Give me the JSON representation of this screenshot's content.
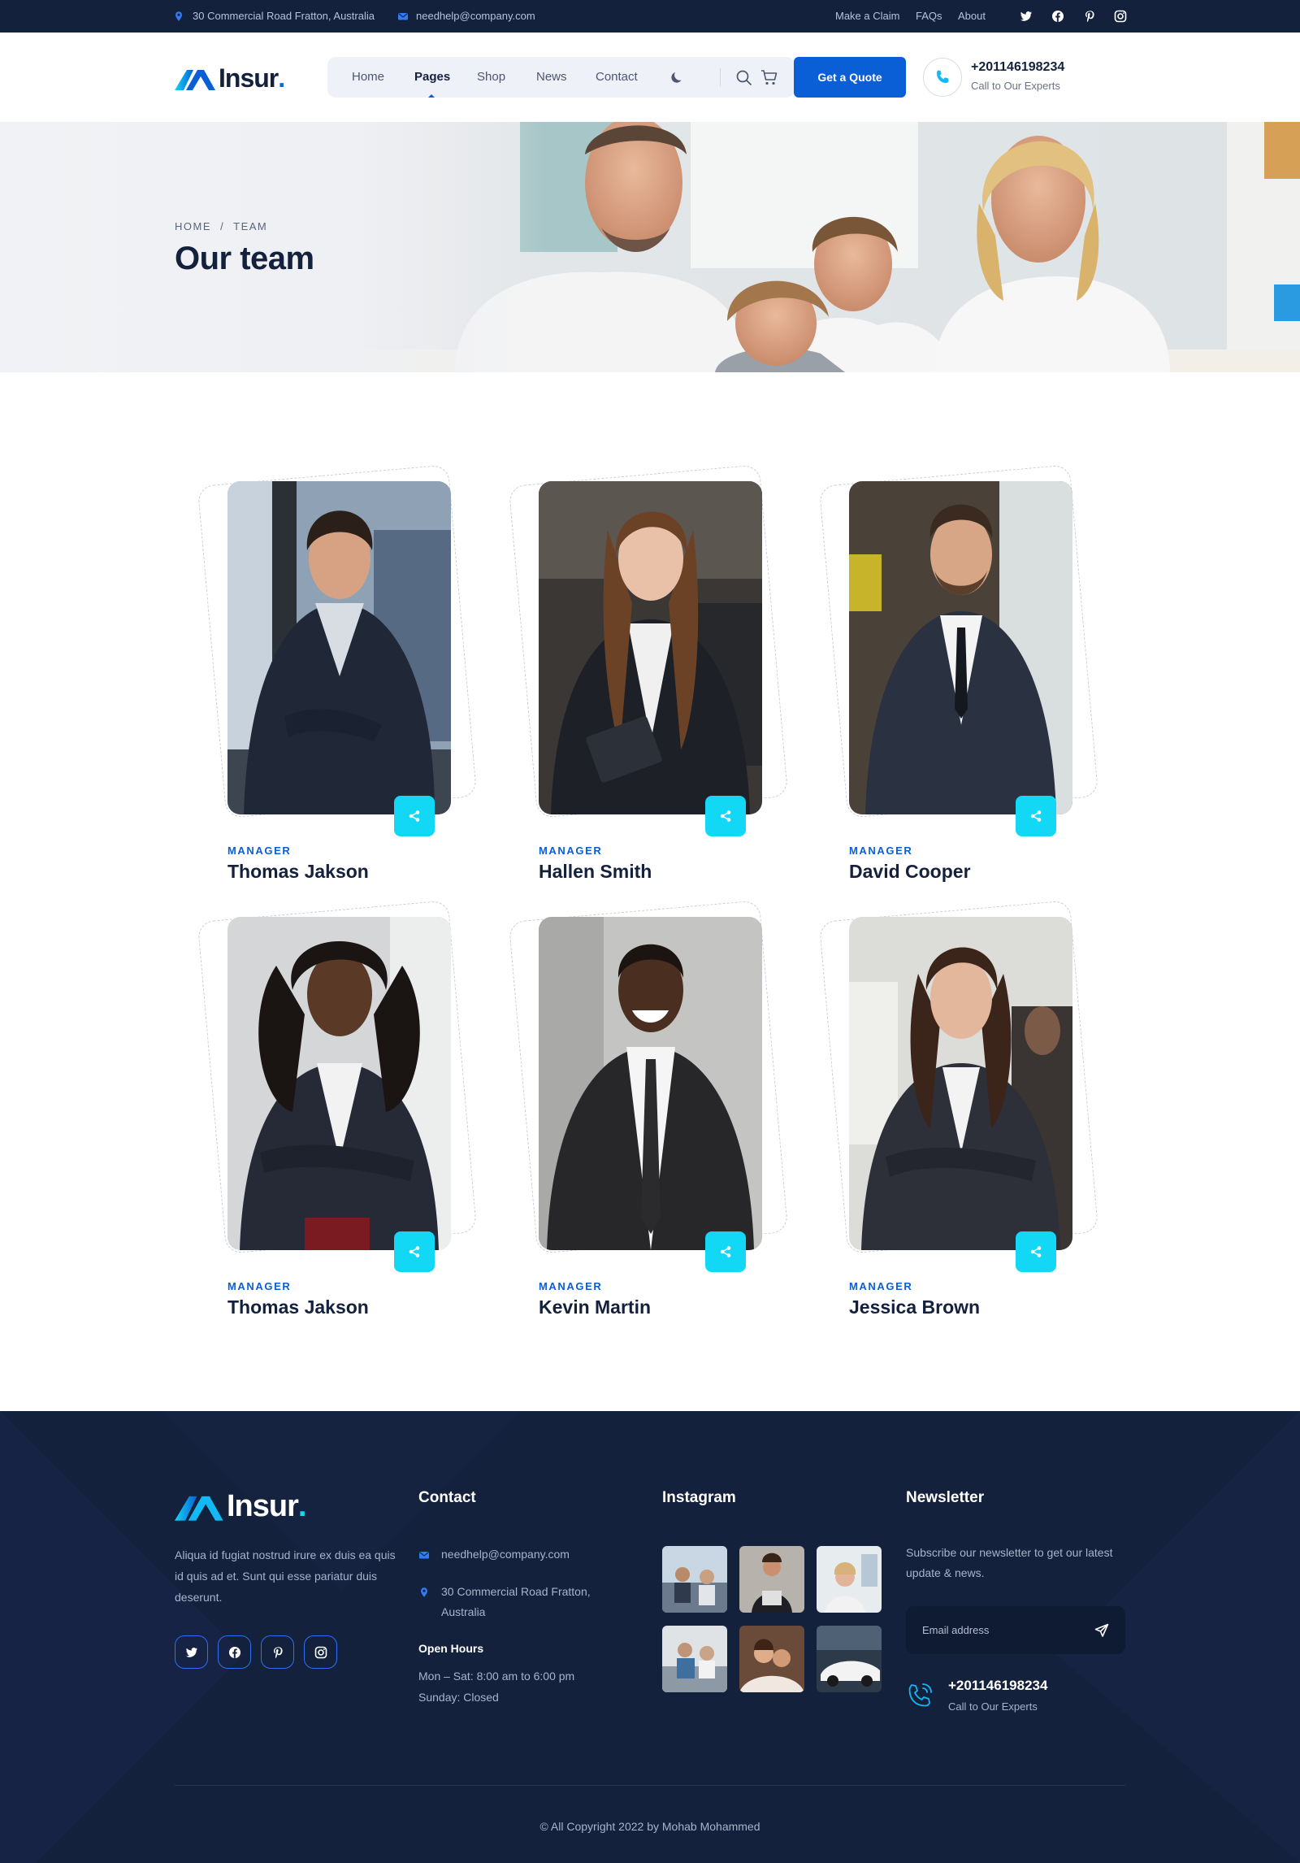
{
  "topbar": {
    "address": "30 Commercial Road Fratton, Australia",
    "email": "needhelp@company.com",
    "links": [
      "Make a Claim",
      "FAQs",
      "About"
    ],
    "social_icons": [
      "twitter-icon",
      "facebook-icon",
      "pinterest-icon",
      "instagram-icon"
    ]
  },
  "header": {
    "logo_text": "Insur",
    "logo_dot": ".",
    "nav": [
      "Home",
      "Pages",
      "Shop",
      "News",
      "Contact"
    ],
    "active_nav": "Pages",
    "quote_button": "Get a Quote",
    "phone": "+201146198234",
    "phone_sub": "Call to Our Experts"
  },
  "hero": {
    "breadcrumb_home": "HOME",
    "breadcrumb_sep": "/",
    "breadcrumb_current": "TEAM",
    "title": "Our team"
  },
  "team": [
    {
      "role": "MANAGER",
      "name": "Thomas Jakson"
    },
    {
      "role": "MANAGER",
      "name": "Hallen Smith"
    },
    {
      "role": "MANAGER",
      "name": "David Cooper"
    },
    {
      "role": "MANAGER",
      "name": "Thomas Jakson"
    },
    {
      "role": "MANAGER",
      "name": "Kevin Martin"
    },
    {
      "role": "MANAGER",
      "name": "Jessica Brown"
    }
  ],
  "footer": {
    "logo_text": "Insur",
    "logo_dot": ".",
    "about": "Aliqua id fugiat nostrud irure ex duis ea quis id quis ad et. Sunt qui esse pariatur duis deserunt.",
    "contact_heading": "Contact",
    "email": "needhelp@company.com",
    "address": "30 Commercial Road Fratton, Australia",
    "hours_heading": "Open Hours",
    "hours_weekdays": "Mon – Sat: 8:00 am to 6:00 pm",
    "hours_sunday": "Sunday: Closed",
    "instagram_heading": "Instagram",
    "newsletter_heading": "Newsletter",
    "newsletter_text": "Subscribe our newsletter to get our latest update & news.",
    "email_placeholder": "Email address",
    "phone": "+201146198234",
    "phone_sub": "Call to Our Experts",
    "copyright": "© All Copyright 2022 by Mohab Mohammed"
  },
  "colors": {
    "navy": "#14213d",
    "primary": "#0a5fd6",
    "accent": "#12d8f5"
  }
}
